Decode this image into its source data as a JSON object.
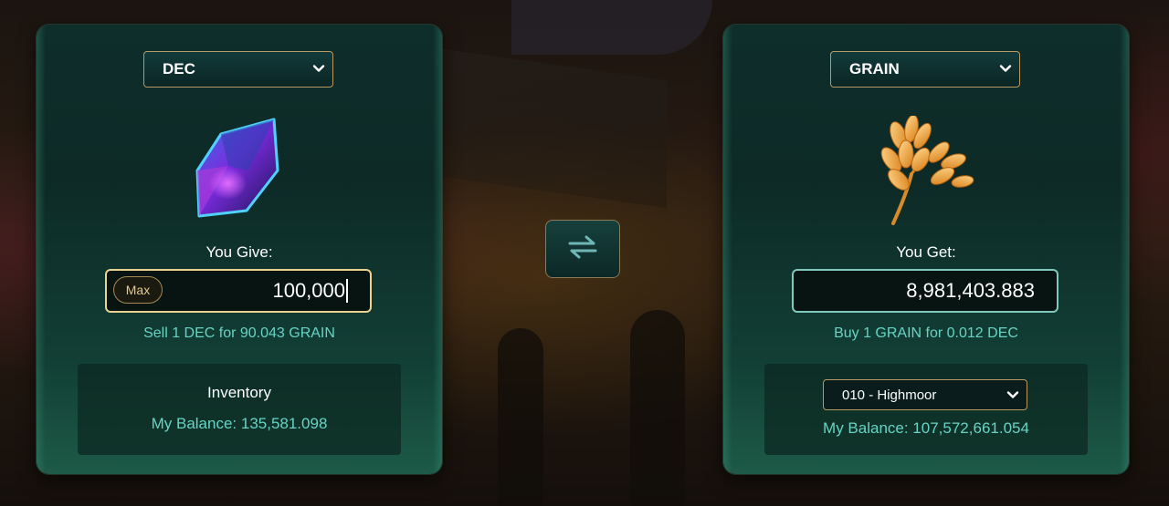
{
  "give": {
    "token": "DEC",
    "label": "You Give:",
    "amount": "100,000",
    "max_label": "Max",
    "rate_text": "Sell 1 DEC for 90.043 GRAIN",
    "inventory_title": "Inventory",
    "balance_text": "My Balance: 135,581.098",
    "icon": "dec-crystal-icon"
  },
  "get": {
    "token": "GRAIN",
    "label": "You Get:",
    "amount": "8,981,403.883",
    "rate_text": "Buy 1 GRAIN for 0.012 DEC",
    "region": "010 - Highmoor",
    "balance_text": "My Balance: 107,572,661.054",
    "icon": "grain-wheat-icon"
  },
  "swap": {
    "icon": "swap-arrows-icon"
  },
  "colors": {
    "accent_teal": "#67d3c5",
    "gold_border": "#b79a63",
    "give_border": "#e9d38e",
    "get_border": "#7fc9bd",
    "panel_bg": "#0d2a26"
  }
}
